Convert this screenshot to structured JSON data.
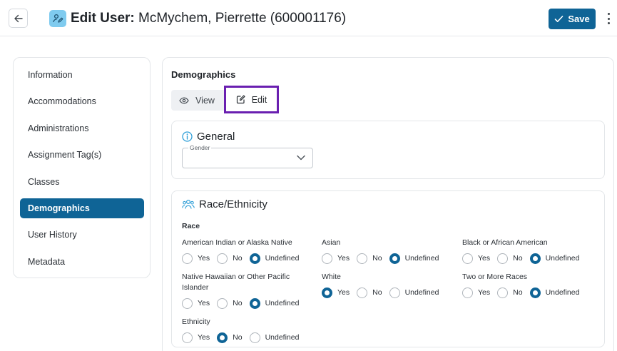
{
  "header": {
    "title_bold": "Edit User",
    "title_rest": "McMychem, Pierrette (600001176)",
    "save_label": "Save"
  },
  "sidebar": {
    "items": [
      {
        "label": "Information",
        "active": false
      },
      {
        "label": "Accommodations",
        "active": false
      },
      {
        "label": "Administrations",
        "active": false
      },
      {
        "label": "Assignment Tag(s)",
        "active": false
      },
      {
        "label": "Classes",
        "active": false
      },
      {
        "label": "Demographics",
        "active": true
      },
      {
        "label": "User History",
        "active": false
      },
      {
        "label": "Metadata",
        "active": false
      }
    ]
  },
  "main": {
    "section_title": "Demographics",
    "toggle": {
      "view_label": "View",
      "edit_label": "Edit",
      "selected": "Edit"
    },
    "general": {
      "title": "General",
      "gender_label": "Gender",
      "gender_value": ""
    },
    "race_ethnicity": {
      "title": "Race/Ethnicity",
      "race_label": "Race",
      "option_labels": [
        "Yes",
        "No",
        "Undefined"
      ],
      "questions": [
        {
          "label": "American Indian or Alaska Native",
          "selected": "Undefined"
        },
        {
          "label": "Asian",
          "selected": "Undefined"
        },
        {
          "label": "Black or African American",
          "selected": "Undefined"
        },
        {
          "label": "Native Hawaiian or Other Pacific Islander",
          "selected": "Undefined"
        },
        {
          "label": "White",
          "selected": "Yes"
        },
        {
          "label": "Two or More Races",
          "selected": "Undefined"
        }
      ],
      "ethnicity": {
        "label": "Ethnicity",
        "selected": "No"
      }
    }
  },
  "colors": {
    "primary": "#0f6496",
    "edit_highlight": "#6a1fb0",
    "icon_accent": "#2f9fd8",
    "user_badge": "#7fcbef"
  }
}
